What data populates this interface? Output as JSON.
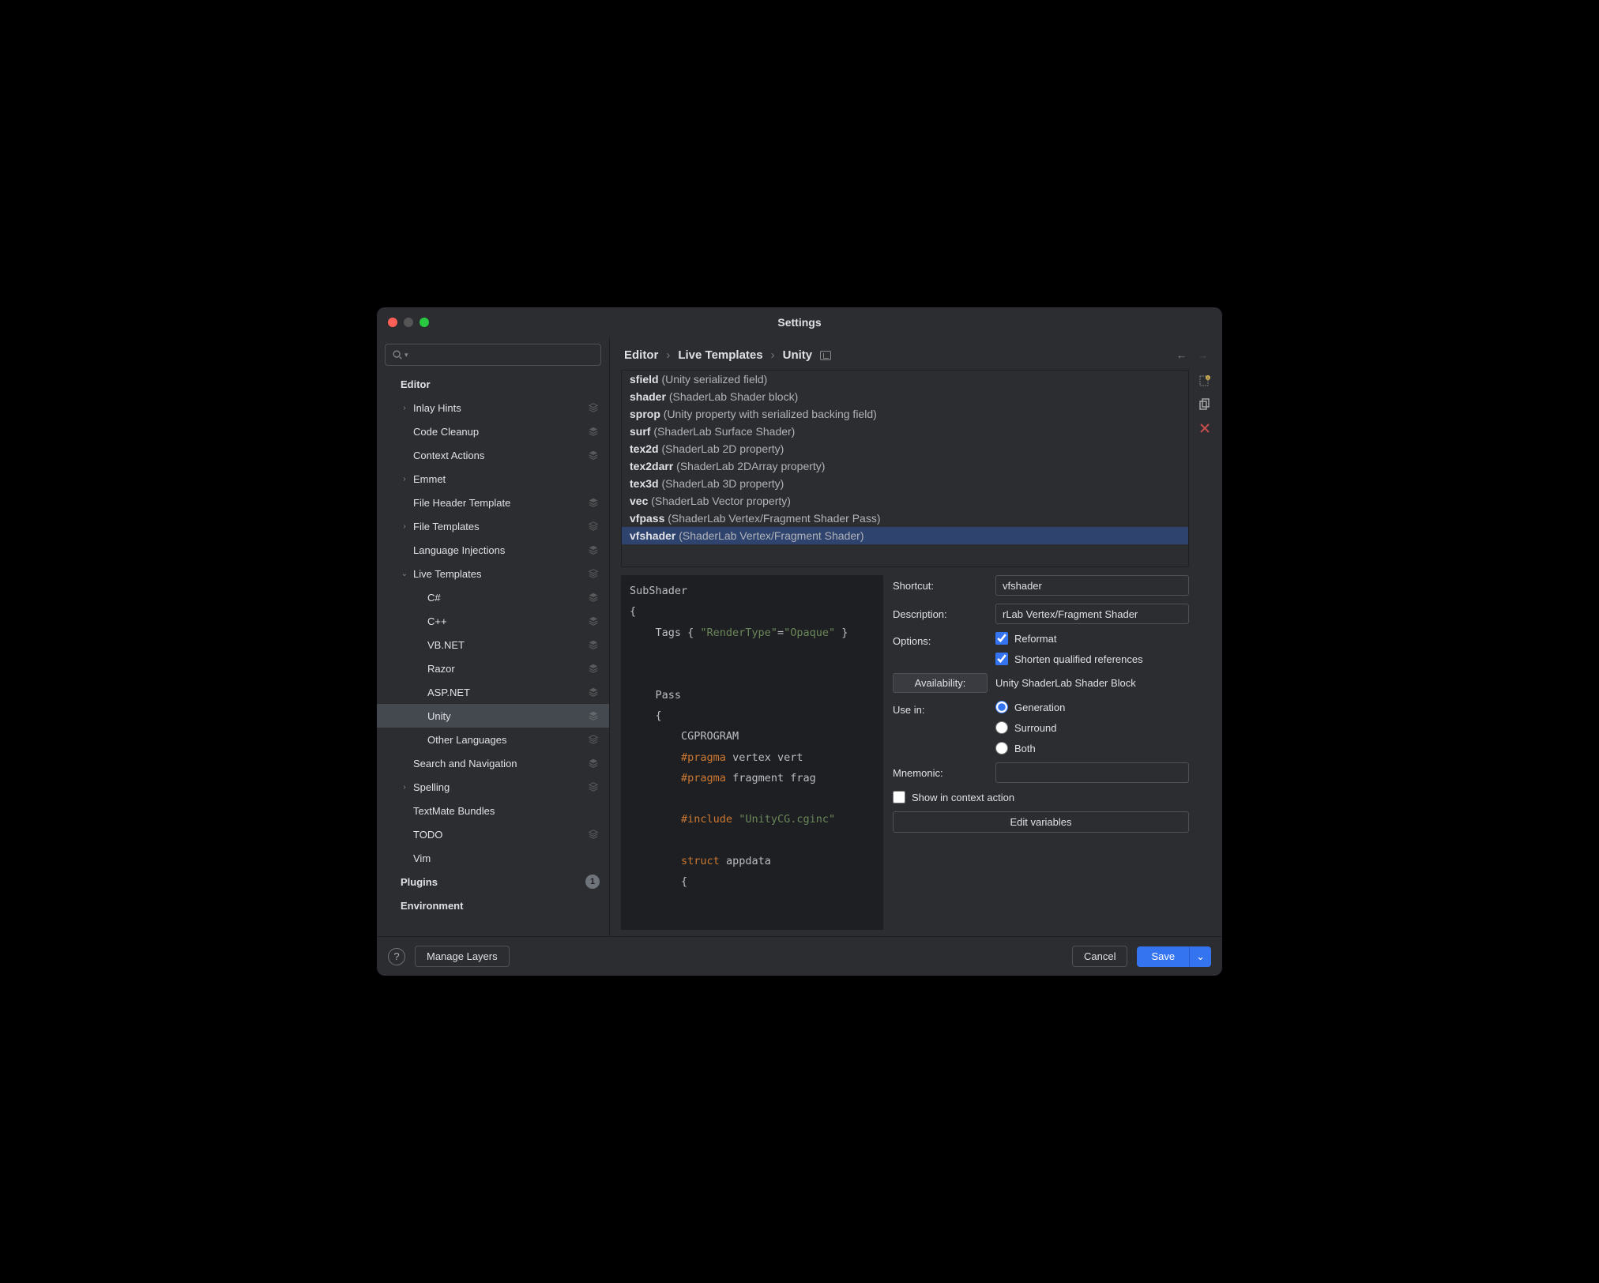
{
  "window": {
    "title": "Settings"
  },
  "search": {
    "placeholder": ""
  },
  "sidebar": {
    "sections": [
      {
        "label": "Editor",
        "bold": true,
        "level": 0
      },
      {
        "label": "Inlay Hints",
        "level": 1,
        "chevron": "right",
        "icon": "outline"
      },
      {
        "label": "Code Cleanup",
        "level": 1,
        "icon": "solid"
      },
      {
        "label": "Context Actions",
        "level": 1,
        "icon": "solid"
      },
      {
        "label": "Emmet",
        "level": 1,
        "chevron": "right"
      },
      {
        "label": "File Header Template",
        "level": 1,
        "icon": "solid"
      },
      {
        "label": "File Templates",
        "level": 1,
        "chevron": "right",
        "icon": "outline"
      },
      {
        "label": "Language Injections",
        "level": 1,
        "icon": "solid"
      },
      {
        "label": "Live Templates",
        "level": 1,
        "chevron": "down",
        "icon": "outline"
      },
      {
        "label": "C#",
        "level": 2,
        "icon": "solid"
      },
      {
        "label": "C++",
        "level": 2,
        "icon": "solid"
      },
      {
        "label": "VB.NET",
        "level": 2,
        "icon": "solid"
      },
      {
        "label": "Razor",
        "level": 2,
        "icon": "solid"
      },
      {
        "label": "ASP.NET",
        "level": 2,
        "icon": "solid"
      },
      {
        "label": "Unity",
        "level": 2,
        "icon": "solid",
        "selected": true
      },
      {
        "label": "Other Languages",
        "level": 2,
        "icon": "outline"
      },
      {
        "label": "Search and Navigation",
        "level": 1,
        "icon": "solid"
      },
      {
        "label": "Spelling",
        "level": 1,
        "chevron": "right",
        "icon": "outline"
      },
      {
        "label": "TextMate Bundles",
        "level": 1
      },
      {
        "label": "TODO",
        "level": 1,
        "icon": "outline"
      },
      {
        "label": "Vim",
        "level": 1
      },
      {
        "label": "Plugins",
        "level": 0,
        "bold": true,
        "badge": "1"
      },
      {
        "label": "Environment",
        "level": 0,
        "bold": true
      }
    ]
  },
  "breadcrumb": {
    "items": [
      "Editor",
      "Live Templates",
      "Unity"
    ]
  },
  "templates": [
    {
      "name": "sfield",
      "desc": "(Unity serialized field)"
    },
    {
      "name": "shader",
      "desc": "(ShaderLab Shader block)"
    },
    {
      "name": "sprop",
      "desc": "(Unity property with serialized backing field)"
    },
    {
      "name": "surf",
      "desc": "(ShaderLab Surface Shader)"
    },
    {
      "name": "tex2d",
      "desc": "(ShaderLab 2D property)"
    },
    {
      "name": "tex2darr",
      "desc": "(ShaderLab 2DArray property)"
    },
    {
      "name": "tex3d",
      "desc": "(ShaderLab 3D property)"
    },
    {
      "name": "vec",
      "desc": "(ShaderLab Vector property)"
    },
    {
      "name": "vfpass",
      "desc": "(ShaderLab Vertex/Fragment Shader Pass)"
    },
    {
      "name": "vfshader",
      "desc": "(ShaderLab Vertex/Fragment Shader)",
      "selected": true
    }
  ],
  "code": {
    "lines": [
      "SubShader",
      "{",
      "    Tags { |STR|\"RenderType\"|/STR|=|STR|\"Opaque\"|/STR| }",
      "",
      "",
      "    Pass",
      "    {",
      "        CGPROGRAM",
      "        |KW|#pragma|/KW| vertex vert",
      "        |KW|#pragma|/KW| fragment frag",
      "",
      "        |KW|#include|/KW| |STR|\"UnityCG.cginc\"|/STR|",
      "",
      "        |KW|struct|/KW| appdata",
      "        {"
    ]
  },
  "form": {
    "shortcut_label": "Shortcut:",
    "shortcut_value": "vfshader",
    "description_label": "Description:",
    "description_value": "rLab Vertex/Fragment Shader",
    "options_label": "Options:",
    "reformat_label": "Reformat",
    "reformat_checked": true,
    "shorten_label": "Shorten qualified references",
    "shorten_checked": true,
    "availability_button": "Availability:",
    "availability_value": "Unity ShaderLab Shader Block",
    "usein_label": "Use in:",
    "radio_generation": "Generation",
    "radio_surround": "Surround",
    "radio_both": "Both",
    "radio_selected": "Generation",
    "mnemonic_label": "Mnemonic:",
    "mnemonic_value": "",
    "show_context_label": "Show in context action",
    "show_context_checked": false,
    "edit_variables": "Edit variables"
  },
  "footer": {
    "help": "?",
    "manage_layers": "Manage Layers",
    "cancel": "Cancel",
    "save": "Save"
  }
}
